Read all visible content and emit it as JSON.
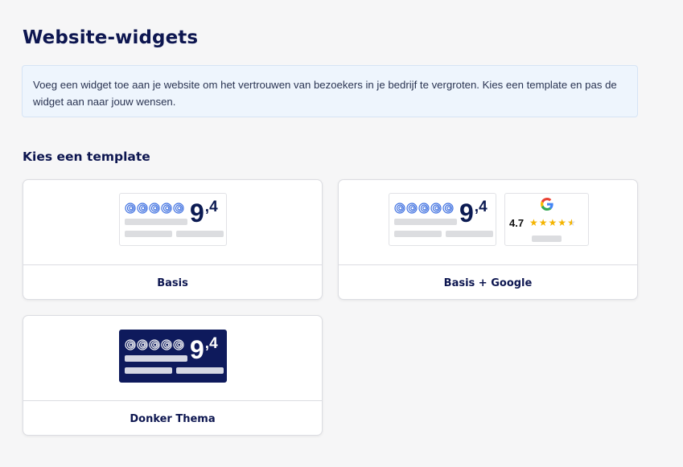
{
  "page": {
    "title": "Website-widgets",
    "info_text": "Voeg een widget toe aan je website om het vertrouwen van bezoekers in je bedrijf te vergroten. Kies een template en pas de widget aan naar jouw wensen.",
    "section_title": "Kies een template"
  },
  "templates": [
    {
      "label": "Basis",
      "score_main": "9",
      "score_decimal": ",4",
      "theme": "light"
    },
    {
      "label": "Basis + Google",
      "score_main": "9",
      "score_decimal": ",4",
      "theme": "light",
      "google_rating": "4.7",
      "google_stars": 4.5
    },
    {
      "label": "Donker Thema",
      "score_main": "9",
      "score_decimal": ",4",
      "theme": "dark"
    }
  ],
  "colors": {
    "brand_navy": "#0d1650",
    "swirl_blue": "#3d6fe0",
    "dark_theme_bg": "#0e1a5c",
    "star_gold": "#f4b400",
    "info_bg": "#eef5fd"
  },
  "icons": [
    "swirl-rating-icon",
    "google-logo-icon",
    "star-icon"
  ]
}
